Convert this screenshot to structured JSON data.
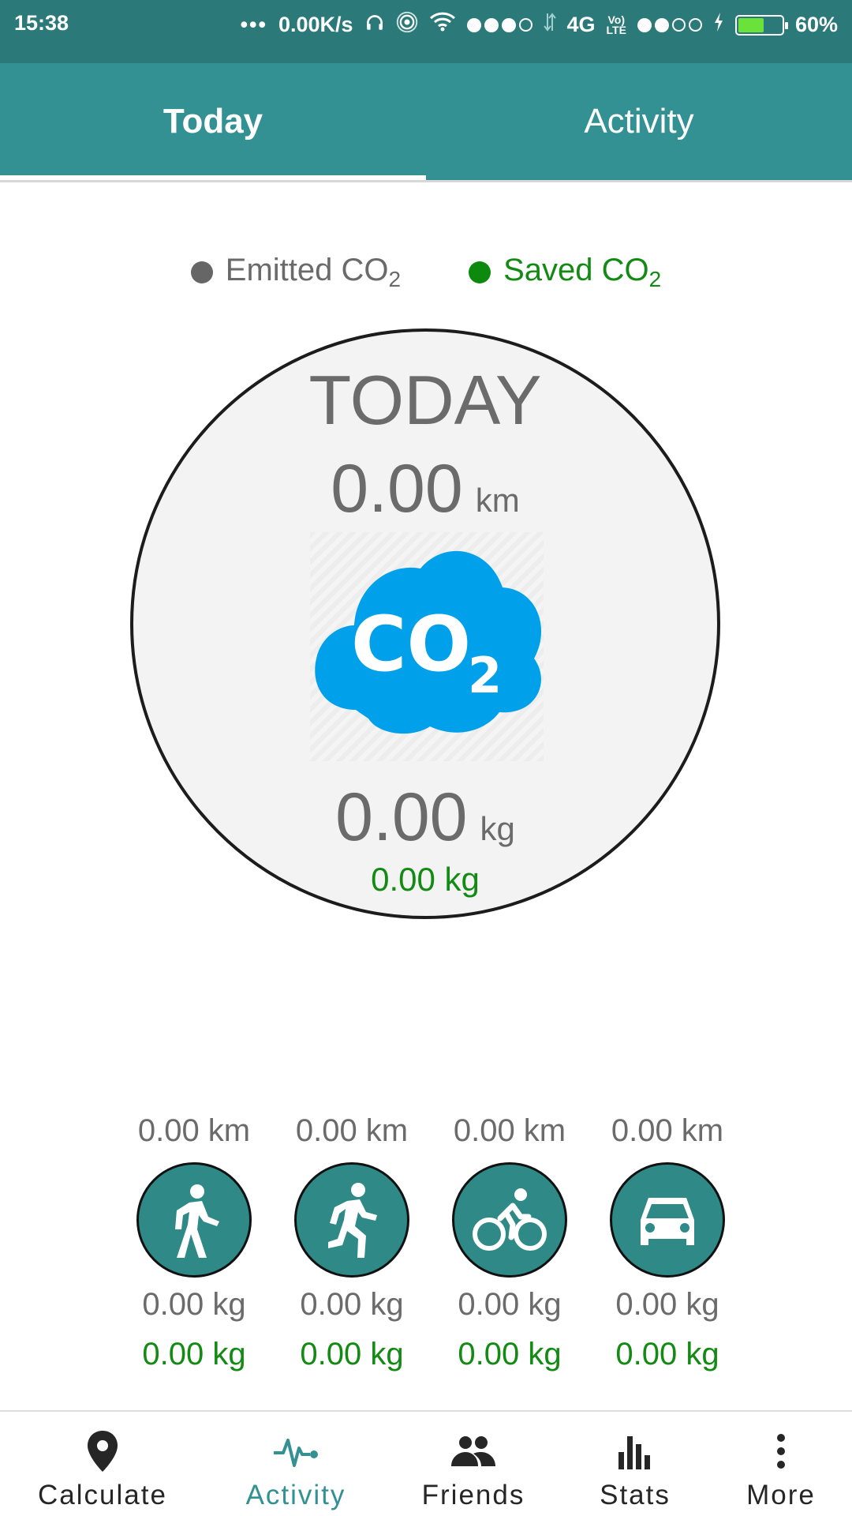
{
  "status_bar": {
    "time": "15:38",
    "more": "•••",
    "net_speed": "0.00K/s",
    "network": "4G",
    "volte_top": "Vo)",
    "volte_bottom": "LTE",
    "battery_percent": "60%",
    "battery_level": 0.6,
    "battery_color": "#6ae23a"
  },
  "tabs": [
    {
      "label": "Today",
      "selected": true
    },
    {
      "label": "Activity",
      "selected": false
    }
  ],
  "legend": {
    "emitted_label": "Emitted CO",
    "emitted_sub": "2",
    "saved_label": "Saved CO",
    "saved_sub": "2",
    "emitted_color": "#666666",
    "saved_color": "#0d8a0d"
  },
  "summary": {
    "title": "TODAY",
    "distance_value": "0.00",
    "distance_unit": "km",
    "emitted_value": "0.00",
    "emitted_unit": "kg",
    "saved_text": "0.00 kg",
    "icon": "co2-cloud-icon",
    "icon_text": "CO",
    "icon_sub": "2",
    "icon_color": "#00a1ea"
  },
  "modes": [
    {
      "name": "walk",
      "icon": "walking-icon",
      "distance": "0.00 km",
      "emitted": "0.00 kg",
      "saved": "0.00 kg"
    },
    {
      "name": "run",
      "icon": "running-icon",
      "distance": "0.00 km",
      "emitted": "0.00 kg",
      "saved": "0.00 kg"
    },
    {
      "name": "bike",
      "icon": "bicycle-icon",
      "distance": "0.00 km",
      "emitted": "0.00 kg",
      "saved": "0.00 kg"
    },
    {
      "name": "car",
      "icon": "car-icon",
      "distance": "0.00 km",
      "emitted": "0.00 kg",
      "saved": "0.00 kg"
    }
  ],
  "bottom_nav": [
    {
      "label": "Calculate",
      "icon": "location-pin-icon",
      "active": false
    },
    {
      "label": "Activity",
      "icon": "activity-pulse-icon",
      "active": true
    },
    {
      "label": "Friends",
      "icon": "people-icon",
      "active": false
    },
    {
      "label": "Stats",
      "icon": "bar-chart-icon",
      "active": false
    },
    {
      "label": "More",
      "icon": "more-vertical-icon",
      "active": false
    }
  ],
  "colors": {
    "status_bar": "#2b7a79",
    "tab_bar": "#339193",
    "mode_button": "#2f8a87",
    "saved_text": "#138a13"
  }
}
